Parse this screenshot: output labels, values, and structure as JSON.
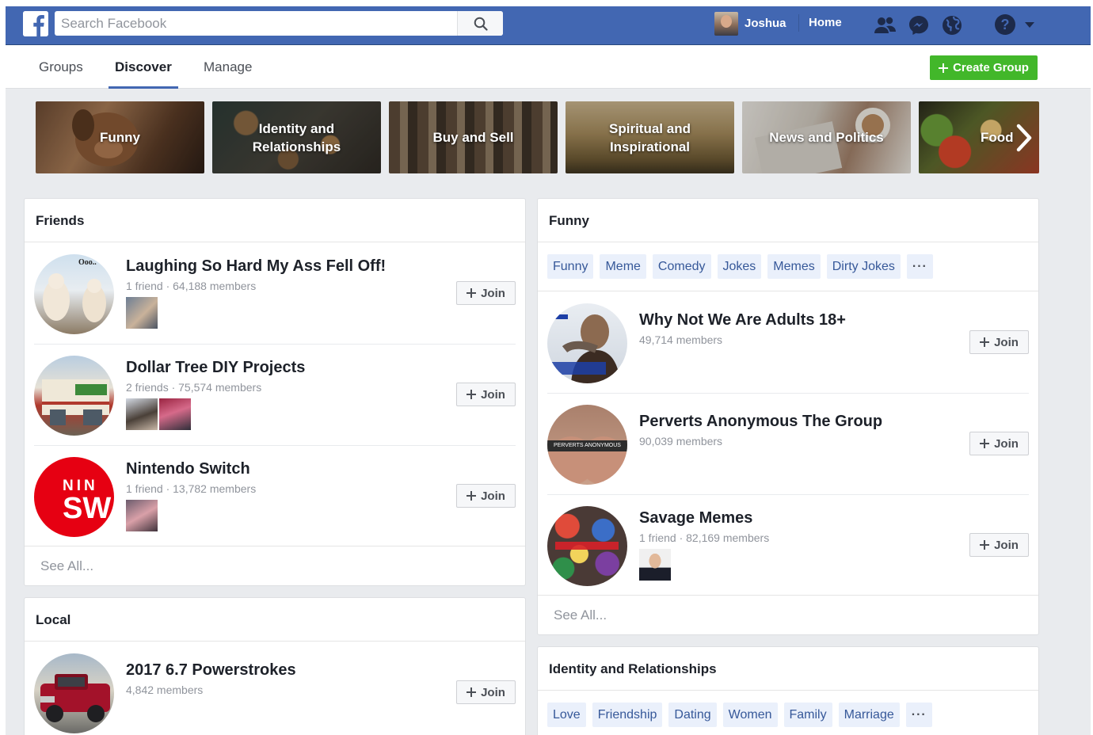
{
  "topbar": {
    "search_placeholder": "Search Facebook",
    "user_name": "Joshua",
    "home_label": "Home",
    "icons": [
      "friend-requests-icon",
      "messenger-icon",
      "notifications-globe-icon",
      "help-icon",
      "account-menu-chevron-icon"
    ]
  },
  "subnav": {
    "tabs": [
      "Groups",
      "Discover",
      "Manage"
    ],
    "active_tab": "Discover",
    "create_label": "Create Group"
  },
  "categories": [
    "Funny",
    "Identity and Relationships",
    "Buy and Sell",
    "Spiritual and Inspirational",
    "News and Politics",
    "Food"
  ],
  "friends_card": {
    "title": "Friends",
    "rows": [
      {
        "title": "Laughing So Hard My Ass Fell Off!",
        "meta": "1 friend · 64,188 members",
        "join": "Join"
      },
      {
        "title": "Dollar Tree DIY Projects",
        "meta": "2 friends · 75,574 members",
        "join": "Join"
      },
      {
        "title": "Nintendo Switch",
        "meta": "1 friend · 13,782 members",
        "join": "Join"
      }
    ],
    "see_all": "See All..."
  },
  "local_card": {
    "title": "Local",
    "rows": [
      {
        "title": "2017 6.7 Powerstrokes",
        "meta": "4,842 members",
        "join": "Join"
      }
    ]
  },
  "funny_card": {
    "title": "Funny",
    "tags": [
      "Funny",
      "Meme",
      "Comedy",
      "Jokes",
      "Memes",
      "Dirty Jokes",
      "···"
    ],
    "rows": [
      {
        "title": "Why Not We Are Adults 18+",
        "meta": "49,714 members",
        "join": "Join"
      },
      {
        "title": "Perverts Anonymous The Group",
        "meta": "90,039 members",
        "join": "Join",
        "avatar_text": "PERVERTS ANONYMOUS"
      },
      {
        "title": "Savage Memes",
        "meta": "1 friend · 82,169 members",
        "join": "Join"
      }
    ],
    "see_all": "See All..."
  },
  "identity_card": {
    "title": "Identity and Relationships",
    "tags": [
      "Love",
      "Friendship",
      "Dating",
      "Women",
      "Family",
      "Marriage",
      "···"
    ]
  },
  "avatar_texts": {
    "nintendo_top": "NIN",
    "nintendo_bottom": "SW"
  },
  "colors": {
    "brand_blue": "#4267b2",
    "create_green": "#42b72a",
    "tag_bg": "#eaf0fb",
    "tag_text": "#365899",
    "nintendo_red": "#e60012"
  }
}
